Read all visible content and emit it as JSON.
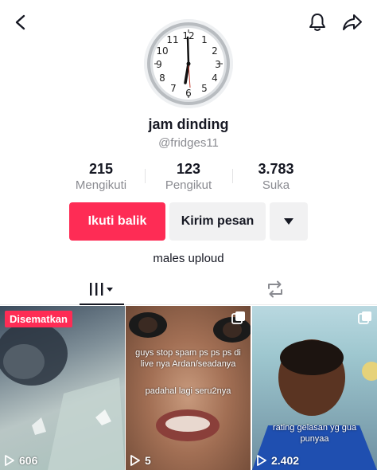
{
  "header": {
    "back_icon": "chevron-left-icon",
    "notification_icon": "bell-icon",
    "share_icon": "share-arrow-icon"
  },
  "profile": {
    "display_name": "jam dinding",
    "username": "@fridges11",
    "avatar_icon": "wall-clock-avatar",
    "bio": "males uploud"
  },
  "stats": [
    {
      "value": "215",
      "label": "Mengikuti"
    },
    {
      "value": "123",
      "label": "Pengikut"
    },
    {
      "value": "3.783",
      "label": "Suka"
    }
  ],
  "actions": {
    "follow_label": "Ikuti balik",
    "message_label": "Kirim pesan",
    "more_icon": "caret-down-icon"
  },
  "colors": {
    "accent": "#fe2c55",
    "text_primary": "#161823",
    "text_secondary": "#8a8b91",
    "button_gray": "#f1f1f2"
  },
  "tabs": [
    {
      "name": "videos",
      "icon": "grid-bars-icon",
      "active": true
    },
    {
      "name": "reposts",
      "icon": "repost-icon",
      "active": false
    }
  ],
  "videos": [
    {
      "pinned_label": "Disematkan",
      "views": "606",
      "caption": ""
    },
    {
      "views": "5",
      "caption": "guys stop spam ps ps ps di live nya Ardan/seadanya",
      "caption2": "padahal lagi seru2nya",
      "multi": true
    },
    {
      "views": "2.402",
      "caption": "rating gelasan yg gua punyaa",
      "multi": true
    }
  ]
}
